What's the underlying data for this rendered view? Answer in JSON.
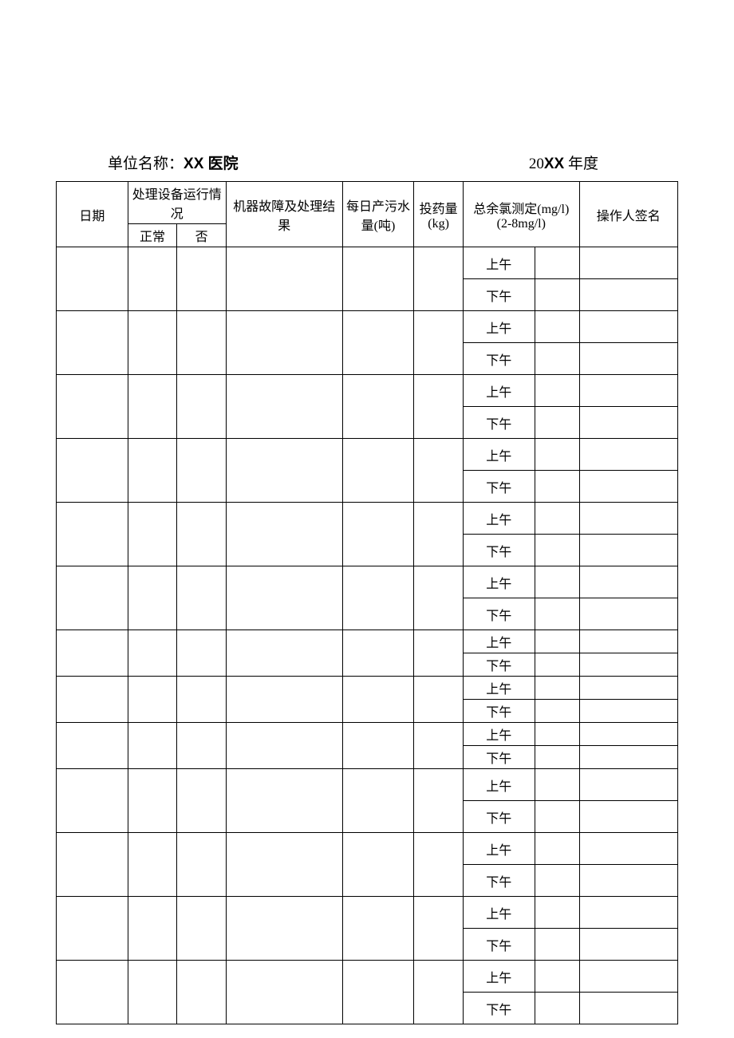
{
  "header": {
    "unit_label": "单位名称：",
    "unit_name": "XX 医院",
    "year_prefix": "20",
    "year_xx": "XX",
    "year_suffix": " 年度"
  },
  "table": {
    "headers": {
      "date": "日期",
      "equipment": "处理设备运行情况",
      "normal": "正常",
      "no": "否",
      "fault_line1": "机器故障及处理结",
      "fault_line2": "果",
      "daily_line1": "每日产污水",
      "daily_line2": "量(吨)",
      "dose_line1": "投药量",
      "dose_line2": "(kg)",
      "chlorine_line1": "总余氯测定(mg/l)",
      "chlorine_line2": "(2-8mg/l)",
      "operator": "操作人签名"
    },
    "timeslots": {
      "am": "上午",
      "pm": "下午"
    },
    "rows": [
      {
        "style": "tall"
      },
      {
        "style": "tall"
      },
      {
        "style": "tall"
      },
      {
        "style": "tall"
      },
      {
        "style": "tall"
      },
      {
        "style": "tall"
      },
      {
        "style": "short"
      },
      {
        "style": "short"
      },
      {
        "style": "short"
      },
      {
        "style": "tall"
      },
      {
        "style": "tall"
      },
      {
        "style": "tall"
      },
      {
        "style": "tall"
      }
    ]
  }
}
